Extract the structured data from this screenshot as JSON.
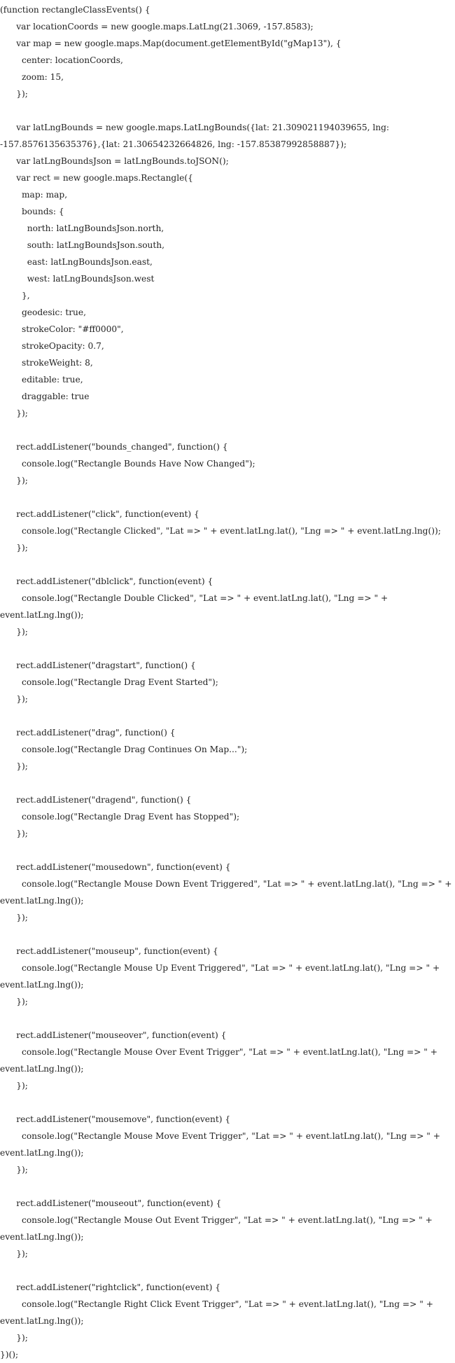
{
  "code": {
    "lines": [
      "(function rectangleClassEvents() {",
      "      var locationCoords = new google.maps.LatLng(21.3069, -157.8583);",
      "      var map = new google.maps.Map(document.getElementById(\"gMap13\"), {",
      "        center: locationCoords,",
      "        zoom: 15,",
      "      });",
      "",
      "      var latLngBounds = new google.maps.LatLngBounds({lat: 21.309021194039655, lng:",
      "-157.8576135635376},{lat: 21.30654232664826, lng: -157.85387992858887});",
      "      var latLngBoundsJson = latLngBounds.toJSON();",
      "      var rect = new google.maps.Rectangle({",
      "        map: map,",
      "        bounds: {",
      "          north: latLngBoundsJson.north,",
      "          south: latLngBoundsJson.south,",
      "          east: latLngBoundsJson.east,",
      "          west: latLngBoundsJson.west",
      "        },",
      "        geodesic: true,",
      "        strokeColor: \"#ff0000\",",
      "        strokeOpacity: 0.7,",
      "        strokeWeight: 8,",
      "        editable: true,",
      "        draggable: true",
      "      });",
      "",
      "      rect.addListener(\"bounds_changed\", function() {",
      "        console.log(\"Rectangle Bounds Have Now Changed\");",
      "      });",
      "",
      "      rect.addListener(\"click\", function(event) {",
      "        console.log(\"Rectangle Clicked\", \"Lat => \" + event.latLng.lat(), \"Lng => \" + event.latLng.lng());",
      "      });",
      "",
      "      rect.addListener(\"dblclick\", function(event) {",
      "        console.log(\"Rectangle Double Clicked\", \"Lat => \" + event.latLng.lat(), \"Lng => \" +",
      "event.latLng.lng());",
      "      });",
      "",
      "      rect.addListener(\"dragstart\", function() {",
      "        console.log(\"Rectangle Drag Event Started\");",
      "      });",
      "",
      "      rect.addListener(\"drag\", function() {",
      "        console.log(\"Rectangle Drag Continues On Map...\");",
      "      });",
      "",
      "      rect.addListener(\"dragend\", function() {",
      "        console.log(\"Rectangle Drag Event has Stopped\");",
      "      });",
      "",
      "      rect.addListener(\"mousedown\", function(event) {",
      "        console.log(\"Rectangle Mouse Down Event Triggered\", \"Lat => \" + event.latLng.lat(), \"Lng => \" +",
      "event.latLng.lng());",
      "      });",
      "",
      "      rect.addListener(\"mouseup\", function(event) {",
      "        console.log(\"Rectangle Mouse Up Event Triggered\", \"Lat => \" + event.latLng.lat(), \"Lng => \" +",
      "event.latLng.lng());",
      "      });",
      "",
      "      rect.addListener(\"mouseover\", function(event) {",
      "        console.log(\"Rectangle Mouse Over Event Trigger\", \"Lat => \" + event.latLng.lat(), \"Lng => \" +",
      "event.latLng.lng());",
      "      });",
      "",
      "      rect.addListener(\"mousemove\", function(event) {",
      "        console.log(\"Rectangle Mouse Move Event Trigger\", \"Lat => \" + event.latLng.lat(), \"Lng => \" +",
      "event.latLng.lng());",
      "      });",
      "",
      "      rect.addListener(\"mouseout\", function(event) {",
      "        console.log(\"Rectangle Mouse Out Event Trigger\", \"Lat => \" + event.latLng.lat(), \"Lng => \" +",
      "event.latLng.lng());",
      "      });",
      "",
      "      rect.addListener(\"rightclick\", function(event) {",
      "        console.log(\"Rectangle Right Click Event Trigger\", \"Lat => \" + event.latLng.lat(), \"Lng => \" +",
      "event.latLng.lng());",
      "      });",
      "})();"
    ]
  }
}
